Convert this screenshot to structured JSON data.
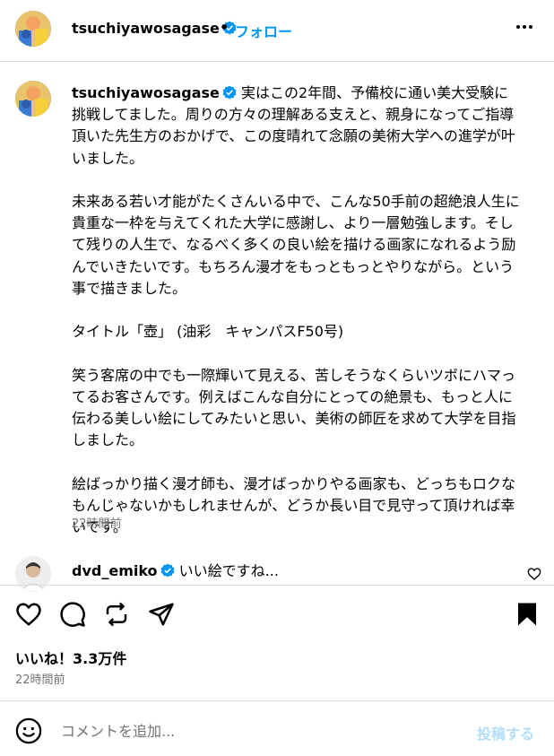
{
  "header": {
    "username": "tsuchiyawosagase",
    "separator": "•",
    "follow_label": "フォロー"
  },
  "caption": {
    "username": "tsuchiyawosagase",
    "text": "実はこの2年間、予備校に通い美大受験に挑戦してました。周りの方々の理解ある支えと、親身になってご指導頂いた先生方のおかげで、この度晴れて念願の美術大学への進学が叶いました。\n\n未来ある若い才能がたくさんいる中で、こんな50手前の超絶浪人生に貴重な一枠を与えてくれた大学に感謝し、より一層勉強します。そして残りの人生で、なるべく多くの良い絵を描ける画家になれるよう励んでいきたいです。もちろん漫才をもっともっとやりながら。という事で描きました。\n\nタイトル「壺」 (油彩　キャンパスF50号)\n\n笑う客席の中でも一際輝いて見える、苦しそうなくらいツボにハマってるお客さんです。例えばこんな自分にとっての絶景も、もっと人に伝わる美しい絵にしてみたいと思い、美術の師匠を求めて大学を目指しました。\n\n絵ばっかり描く漫才師も、漫才ばっかりやる画家も、どっちもロクなもんじゃないかもしれませんが、どうか長い目で見守って頂ければ幸いです。",
    "time": "22時間前"
  },
  "comment": {
    "username": "dvd_emiko",
    "text": "いい絵ですね..."
  },
  "likes_label": "いいね！3.3万件",
  "post_time": "22時間前",
  "compose": {
    "placeholder": "コメントを追加...",
    "post_label": "投稿する"
  },
  "icons": {
    "verified": "verified-badge-icon",
    "more": "more-options-icon",
    "like": "heart-icon",
    "comment": "comment-bubble-icon",
    "share": "repost-icon",
    "send": "send-icon",
    "save": "bookmark-filled-icon",
    "emoji": "emoji-icon"
  },
  "colors": {
    "accent": "#0095f6",
    "verified": "#0095f6",
    "secondary_text": "#737373",
    "post_disabled": "#b2dffc",
    "divider": "#dbdbdb"
  }
}
